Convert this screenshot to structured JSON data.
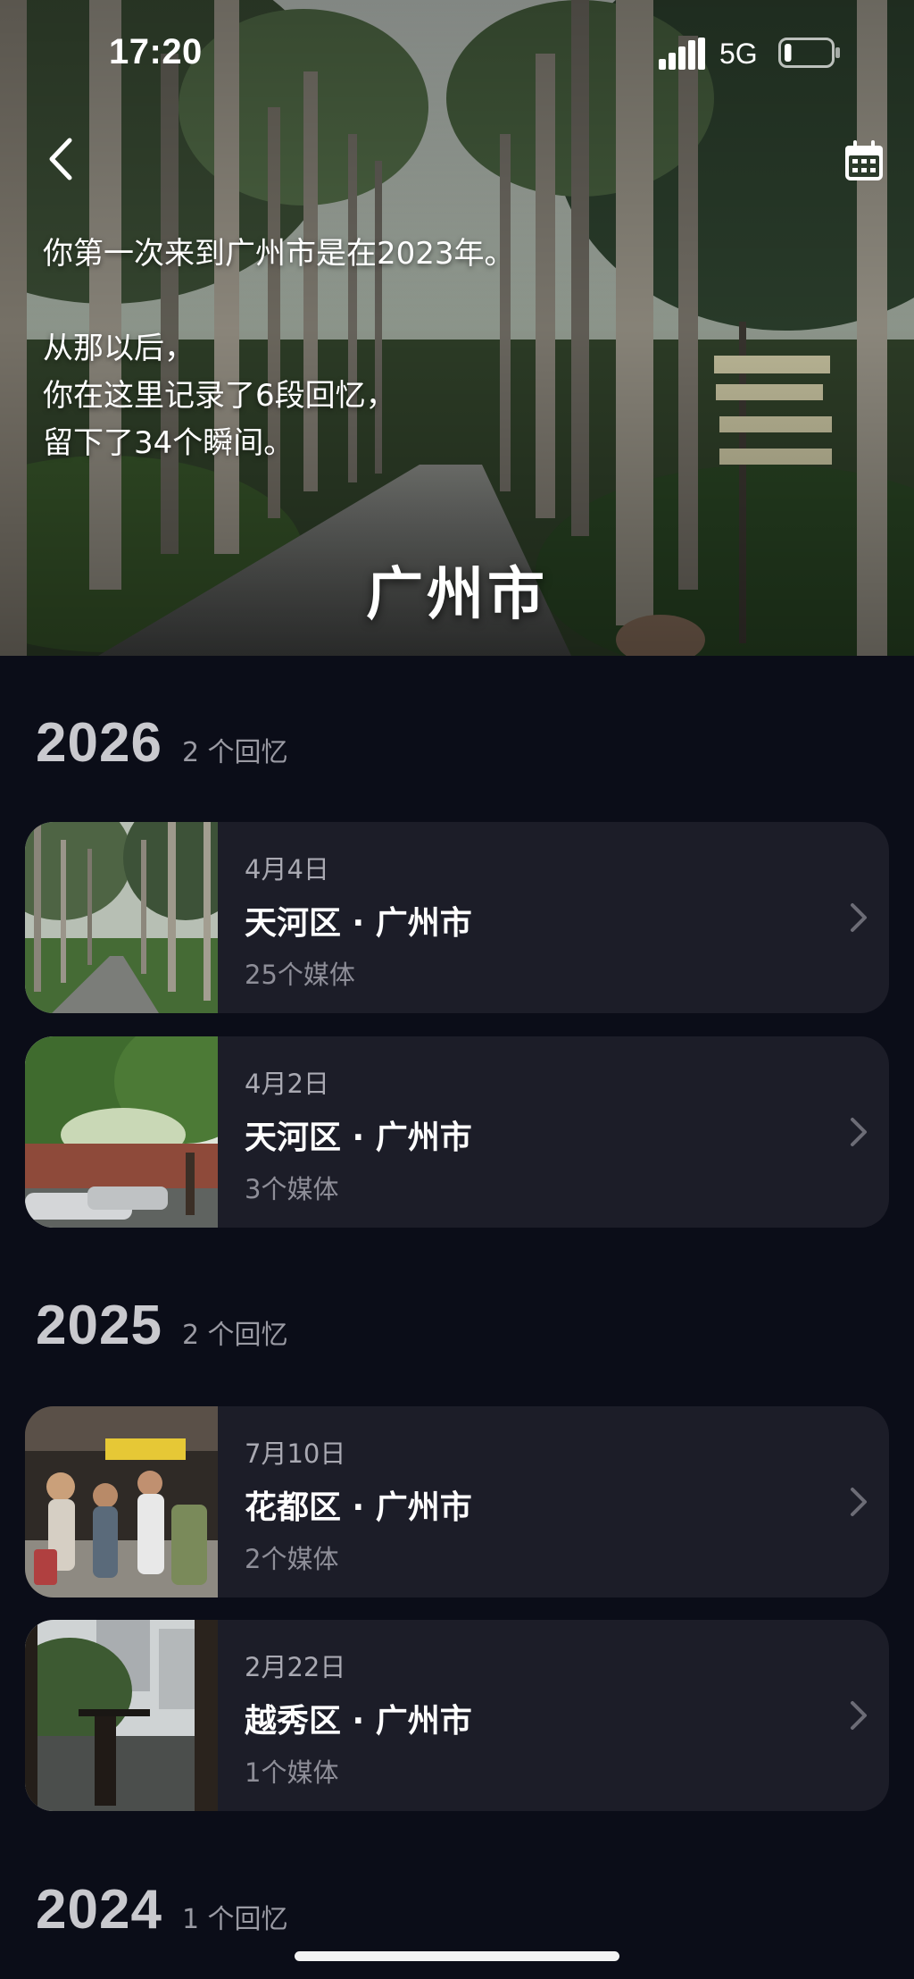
{
  "status_bar": {
    "time": "17:20",
    "network": "5G",
    "battery_level": 0.15
  },
  "hero": {
    "intro_line1": "你第一次来到广州市是在2023年。",
    "intro_line2": "从那以后，",
    "intro_line3": "你在这里记录了6段回忆，",
    "intro_line4": "留下了34个瞬间。",
    "title": "广州市"
  },
  "years": [
    {
      "year": "2026",
      "count": "2 个回忆",
      "entries": [
        {
          "date": "4月4日",
          "title": "天河区 · 广州市",
          "media": "25个媒体"
        },
        {
          "date": "4月2日",
          "title": "天河区 · 广州市",
          "media": "3个媒体"
        }
      ]
    },
    {
      "year": "2025",
      "count": "2 个回忆",
      "entries": [
        {
          "date": "7月10日",
          "title": "花都区 · 广州市",
          "media": "2个媒体"
        },
        {
          "date": "2月22日",
          "title": "越秀区 · 广州市",
          "media": "1个媒体"
        }
      ]
    },
    {
      "year": "2024",
      "count": "1 个回忆",
      "entries": []
    }
  ],
  "icons": {
    "back": "chevron-left-icon",
    "calendar": "calendar-icon",
    "row_chevron": "chevron-right-icon"
  },
  "colors": {
    "background": "#0b0d18",
    "card": "#1c1d28",
    "year_text": "#c9c9ce",
    "muted_text": "#9a9aa3"
  }
}
